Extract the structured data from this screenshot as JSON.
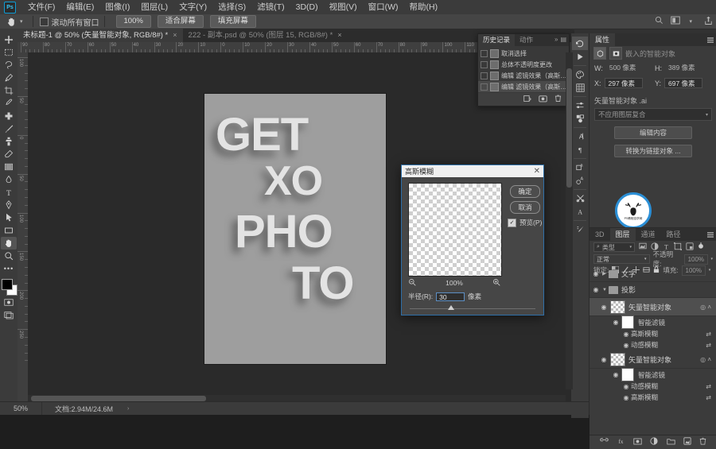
{
  "app": {
    "name": "Photoshop",
    "logo": "Ps"
  },
  "menubar": {
    "items": [
      {
        "label": "文件(F)"
      },
      {
        "label": "编辑(E)"
      },
      {
        "label": "图像(I)"
      },
      {
        "label": "图层(L)"
      },
      {
        "label": "文字(Y)"
      },
      {
        "label": "选择(S)"
      },
      {
        "label": "滤镜(T)"
      },
      {
        "label": "3D(D)"
      },
      {
        "label": "视图(V)"
      },
      {
        "label": "窗口(W)"
      },
      {
        "label": "帮助(H)"
      }
    ]
  },
  "optionsbar": {
    "tool_icon": "hand-icon",
    "scroll_all_windows": "滚动所有窗口",
    "zoom_value": "100%",
    "fit_screen": "适合屏幕",
    "fill_screen": "填充屏幕",
    "search_icon": "search-icon",
    "workspace_icon": "workspace-icon",
    "share_icon": "share-icon"
  },
  "tabs": [
    {
      "label": "未标题-1 @ 50% (矢量智能对象, RGB/8#) *",
      "active": true,
      "close": "×"
    },
    {
      "label": "222 - 副本.psd @ 50% (图层 15, RGB/8#) *",
      "active": false,
      "close": "×"
    }
  ],
  "toolbar": {
    "tools": [
      {
        "name": "move-tool",
        "glyph": "✥"
      },
      {
        "name": "marquee-tool",
        "glyph": "▢"
      },
      {
        "name": "lasso-tool",
        "glyph": "✦"
      },
      {
        "name": "quick-select-tool",
        "glyph": "✐"
      },
      {
        "name": "crop-tool",
        "glyph": "⌗"
      },
      {
        "name": "eyedropper-tool",
        "glyph": "✎"
      },
      {
        "name": "healing-brush-tool",
        "glyph": "⚕"
      },
      {
        "name": "brush-tool",
        "glyph": "✏"
      },
      {
        "name": "clone-stamp-tool",
        "glyph": "⚲"
      },
      {
        "name": "eraser-tool",
        "glyph": "◧"
      },
      {
        "name": "gradient-tool",
        "glyph": "◐"
      },
      {
        "name": "blur-tool",
        "glyph": "◉"
      },
      {
        "name": "type-tool",
        "glyph": "T"
      },
      {
        "name": "pen-tool",
        "glyph": "✒"
      },
      {
        "name": "path-select-tool",
        "glyph": "➤"
      },
      {
        "name": "rectangle-tool",
        "glyph": "▭"
      },
      {
        "name": "hand-tool",
        "glyph": "✋",
        "selected": true
      },
      {
        "name": "zoom-tool",
        "glyph": "🔍"
      },
      {
        "name": "more-tools",
        "glyph": "•••"
      }
    ],
    "foreground_color": "#000000",
    "background_color": "#ffffff"
  },
  "rulers": {
    "h_labels": [
      "90",
      "80",
      "70",
      "60",
      "50",
      "40",
      "30",
      "20",
      "10",
      "0",
      "10",
      "20",
      "30",
      "40",
      "50",
      "60",
      "70",
      "80",
      "90",
      "100",
      "110",
      "120",
      "130",
      "140"
    ],
    "v_labels": [
      "100",
      "50",
      "0",
      "50",
      "100",
      "150",
      "200",
      "250"
    ]
  },
  "canvas": {
    "poster_lines": [
      "GET",
      "XO",
      "PHO",
      "TO"
    ],
    "background_color": "#9e9e9e",
    "text_color": "#e3e3e3"
  },
  "history_panel": {
    "tabs": [
      {
        "label": "历史记录",
        "active": true
      },
      {
        "label": "动作",
        "active": false
      }
    ],
    "expand_icon": "»",
    "menu_icon": "panel-menu-icon",
    "items": [
      {
        "label": "取消选择",
        "selected": false
      },
      {
        "label": "总体不透明度更改",
        "selected": false
      },
      {
        "label": "编辑 滤镜效果（高斯…",
        "selected": false
      },
      {
        "label": "编辑 滤镜效果（高斯…",
        "selected": true
      }
    ],
    "footer_icons": [
      "new-document-from-state-icon",
      "new-snapshot-icon",
      "delete-icon"
    ]
  },
  "dialog": {
    "title": "高斯模糊",
    "close": "✕",
    "ok": "确定",
    "cancel": "取消",
    "preview_label": "预览(P)",
    "preview_checked": "✓",
    "zoom_out_icon": "zoom-out-icon",
    "zoom_in_icon": "zoom-in-icon",
    "zoom_value": "100%",
    "radius_label": "半径(R):",
    "radius_value": "30",
    "radius_unit": "像素"
  },
  "icon_rail": {
    "icons": [
      {
        "name": "history-icon",
        "glyph": "↺",
        "selected": true
      },
      {
        "name": "actions-icon",
        "glyph": "▶"
      },
      {
        "name": "color-icon",
        "glyph": "◍"
      },
      {
        "name": "swatches-icon",
        "glyph": "▦"
      },
      {
        "name": "adjustments-icon",
        "glyph": "⇄"
      },
      {
        "name": "styles-icon",
        "glyph": "⚘"
      },
      {
        "name": "character-icon",
        "glyph": "A"
      },
      {
        "name": "paragraph-icon",
        "glyph": "¶"
      },
      {
        "name": "character-styles-icon",
        "glyph": "⌸"
      },
      {
        "name": "paragraph-styles-icon",
        "glyph": "⌹"
      },
      {
        "name": "tool-presets-icon",
        "glyph": "✂"
      },
      {
        "name": "glyphs-icon",
        "glyph": "Ꭿ"
      },
      {
        "name": "brush-settings-icon",
        "glyph": "✐"
      }
    ]
  },
  "properties_panel": {
    "tabs": [
      {
        "label": "属性",
        "active": true
      }
    ],
    "menu_icon": "panel-menu-icon",
    "header": "嵌入的智能对象",
    "w_label": "W:",
    "w_value": "500 像素",
    "h_label": "H:",
    "h_value": "389 像素",
    "x_label": "X:",
    "x_value": "297 像素",
    "y_label": "Y:",
    "y_value": "697 像素",
    "source_name": "矢量智能对象 .ai",
    "layer_comp": "不应用图层复合",
    "edit_content": "编辑内容",
    "convert_linked": "转换为链接对象 ..."
  },
  "watermark": {
    "text": "PS教程自学网"
  },
  "layers_panel": {
    "tabs": [
      {
        "label": "3D",
        "active": false
      },
      {
        "label": "图层",
        "active": true
      },
      {
        "label": "通道",
        "active": false
      },
      {
        "label": "路径",
        "active": false
      }
    ],
    "menu_icon": "panel-menu-icon",
    "filter_label": "类型",
    "filter_icons": [
      "pixel-filter-icon",
      "adjustment-filter-icon",
      "type-filter-icon",
      "shape-filter-icon",
      "smart-object-filter-icon"
    ],
    "filter_toggle": "filter-power-icon",
    "blend_mode": "正常",
    "opacity_label": "不透明度:",
    "opacity_value": "100%",
    "lock_label": "锁定:",
    "lock_icons": [
      "lock-transparent-icon",
      "lock-image-icon",
      "lock-position-icon",
      "lock-artboard-icon",
      "lock-all-icon"
    ],
    "fill_label": "填充:",
    "fill_value": "100%",
    "rows": [
      {
        "type": "group",
        "label": "文字",
        "expanded": false,
        "visible": true
      },
      {
        "type": "group",
        "label": "投影",
        "expanded": true,
        "visible": true
      },
      {
        "type": "smartobject",
        "label": "矢量智能对象",
        "selected": true,
        "visible": true,
        "fx": "smart-filter-icon"
      },
      {
        "type": "filtergroup",
        "label": "智能滤镜",
        "visible": true
      },
      {
        "type": "filter",
        "label": "高斯模糊",
        "visible": true,
        "blend": "filter-options-icon"
      },
      {
        "type": "filter",
        "label": "动感模糊",
        "visible": true,
        "blend": "filter-options-icon"
      },
      {
        "type": "smartobject",
        "label": "矢量智能对象",
        "selected": false,
        "visible": true,
        "fx": "smart-filter-icon"
      },
      {
        "type": "filtergroup",
        "label": "智能滤镜",
        "visible": true
      },
      {
        "type": "filter",
        "label": "动感模糊",
        "visible": true,
        "blend": "filter-options-icon"
      },
      {
        "type": "filter",
        "label": "高斯模糊",
        "visible": true,
        "blend": "filter-options-icon"
      }
    ],
    "footer_icons": [
      "link-layers-icon",
      "add-style-icon",
      "add-mask-icon",
      "adjustment-layer-icon",
      "new-group-icon",
      "new-layer-icon",
      "delete-layer-icon"
    ]
  },
  "statusbar": {
    "zoom": "50%",
    "doc_info": "文档:2.94M/24.6M",
    "expand_arrow": "›"
  }
}
